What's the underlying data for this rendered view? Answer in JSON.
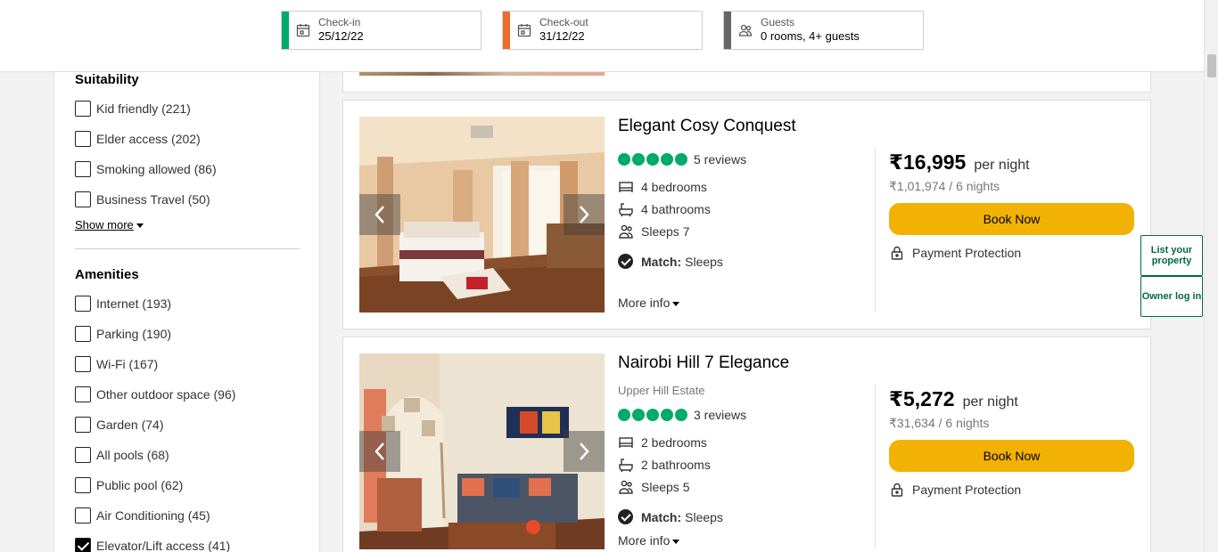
{
  "header": {
    "checkin": {
      "label": "Check-in",
      "value": "25/12/22",
      "color": "#00aa6c",
      "icon": "calendar-icon"
    },
    "checkout": {
      "label": "Check-out",
      "value": "31/12/22",
      "color": "#f26b2a",
      "icon": "calendar-icon"
    },
    "guests": {
      "label": "Guests",
      "value": "0 rooms, 4+ guests",
      "color": "#666666",
      "icon": "people-icon"
    }
  },
  "sidebar": {
    "suitability": {
      "title": "Suitability",
      "items": [
        {
          "label": "Kid friendly (221)",
          "checked": false
        },
        {
          "label": "Elder access (202)",
          "checked": false
        },
        {
          "label": "Smoking allowed (86)",
          "checked": false
        },
        {
          "label": "Business Travel (50)",
          "checked": false
        }
      ],
      "show_more": "Show more"
    },
    "amenities": {
      "title": "Amenities",
      "items": [
        {
          "label": "Internet (193)",
          "checked": false
        },
        {
          "label": "Parking (190)",
          "checked": false
        },
        {
          "label": "Wi-Fi (167)",
          "checked": false
        },
        {
          "label": "Other outdoor space (96)",
          "checked": false
        },
        {
          "label": "Garden (74)",
          "checked": false
        },
        {
          "label": "All pools (68)",
          "checked": false
        },
        {
          "label": "Public pool (62)",
          "checked": false
        },
        {
          "label": "Air Conditioning (45)",
          "checked": false
        },
        {
          "label": "Elevator/Lift access (41)",
          "checked": true
        }
      ]
    }
  },
  "listings": [
    {
      "title": "Elegant Cosy Conquest",
      "area": "",
      "rating_bubbles": 5,
      "reviews": "5 reviews",
      "bedrooms": "4 bedrooms",
      "bathrooms": "4 bathrooms",
      "sleeps": "Sleeps 7",
      "match_label": "Match:",
      "match_value": "Sleeps",
      "more_info": "More info",
      "price": "₹16,995",
      "per": "per night",
      "total": "₹1,01,974 / 6 nights",
      "book": "Book Now",
      "protection": "Payment Protection"
    },
    {
      "title": "Nairobi Hill 7 Elegance",
      "area": "Upper Hill Estate",
      "rating_bubbles": 5,
      "reviews": "3 reviews",
      "bedrooms": "2 bedrooms",
      "bathrooms": "2 bathrooms",
      "sleeps": "Sleeps 5",
      "match_label": "Match:",
      "match_value": "Sleeps",
      "more_info": "More info",
      "price": "₹5,272",
      "per": "per night",
      "total": "₹31,634 / 6 nights",
      "book": "Book Now",
      "protection": "Payment Protection"
    }
  ],
  "side_buttons": {
    "list_property": "List your property",
    "owner_login": "Owner log in"
  },
  "colors": {
    "book_button": "#f2b203",
    "rating": "#00aa6c",
    "owner_green": "#006b3c"
  }
}
